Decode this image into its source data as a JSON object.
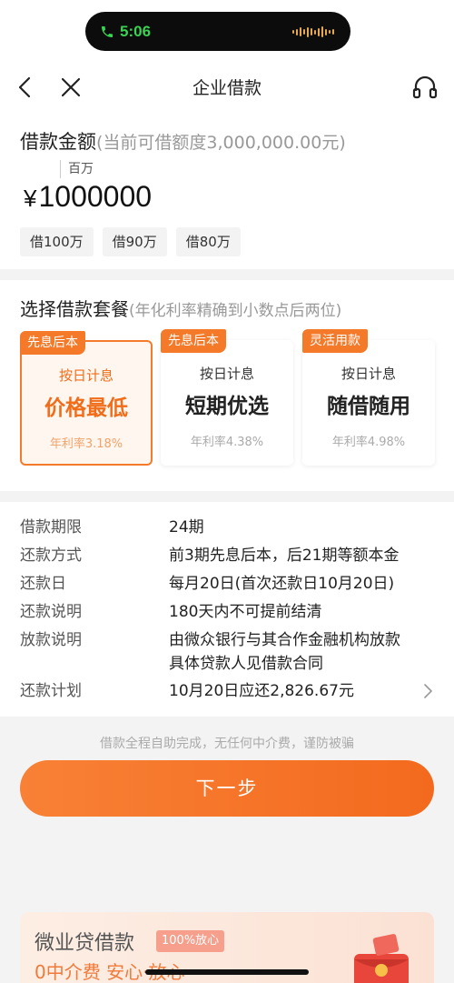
{
  "status_bar": {
    "time": "5:06"
  },
  "nav": {
    "title": "企业借款"
  },
  "amount": {
    "title": "借款金额",
    "limit_hint": "(当前可借额度3,000,000.00元)",
    "unit_hint": "百万",
    "currency": "¥",
    "value": "1000000",
    "quick_chips": [
      {
        "label": "借100万"
      },
      {
        "label": "借90万"
      },
      {
        "label": "借80万"
      }
    ]
  },
  "plans": {
    "title": "选择借款套餐",
    "hint": "(年化利率精确到小数点后两位)",
    "items": [
      {
        "tag": "先息后本",
        "sub": "按日计息",
        "name": "价格最低",
        "rate": "年利率3.18%",
        "selected": true
      },
      {
        "tag": "先息后本",
        "sub": "按日计息",
        "name": "短期优选",
        "rate": "年利率4.38%",
        "selected": false
      },
      {
        "tag": "灵活用款",
        "sub": "按日计息",
        "name": "随借随用",
        "rate": "年利率4.98%",
        "selected": false
      }
    ]
  },
  "details": {
    "term": {
      "label": "借款期限",
      "value": "24期"
    },
    "method": {
      "label": "还款方式",
      "value": "前3期先息后本，后21期等额本金"
    },
    "day": {
      "label": "还款日",
      "value": "每月20日(首次还款日10月20日)"
    },
    "note": {
      "label": "还款说明",
      "value": "180天内不可提前结清"
    },
    "lender": {
      "label": "放款说明",
      "value": "由微众银行与其合作金融机构放款",
      "value2": "具体贷款人见借款合同"
    },
    "plan": {
      "label": "还款计划",
      "value": "10月20日应还2,826.67元"
    }
  },
  "footer": {
    "notice": "借款全程自助完成，无任何中介费，谨防被骗",
    "next_button": "下一步"
  },
  "promo": {
    "title": "微业贷借款",
    "badge": "100%放心",
    "subtitle": "0中介费 安心·放心"
  },
  "colors": {
    "accent": "#f37b2b",
    "background": "#f3f3f3"
  }
}
